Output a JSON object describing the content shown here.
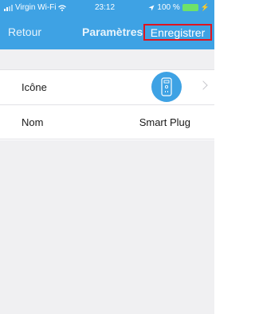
{
  "status_bar": {
    "carrier": "Virgin Wi-Fi",
    "time": "23:12",
    "battery_percent": "100 %",
    "icons": [
      "signal-icon",
      "wifi-icon",
      "location-icon",
      "battery-icon",
      "charging-icon"
    ]
  },
  "nav": {
    "back_label": "Retour",
    "title": "Paramètres",
    "save_label": "Enregistrer"
  },
  "settings": {
    "icon_label": "Icône",
    "icon_name": "smart-plug-icon",
    "name_label": "Nom",
    "name_value": "Smart Plug"
  },
  "colors": {
    "header": "#3ea2e4",
    "highlight_border": "#e0141e",
    "background": "#f0f0f2"
  }
}
